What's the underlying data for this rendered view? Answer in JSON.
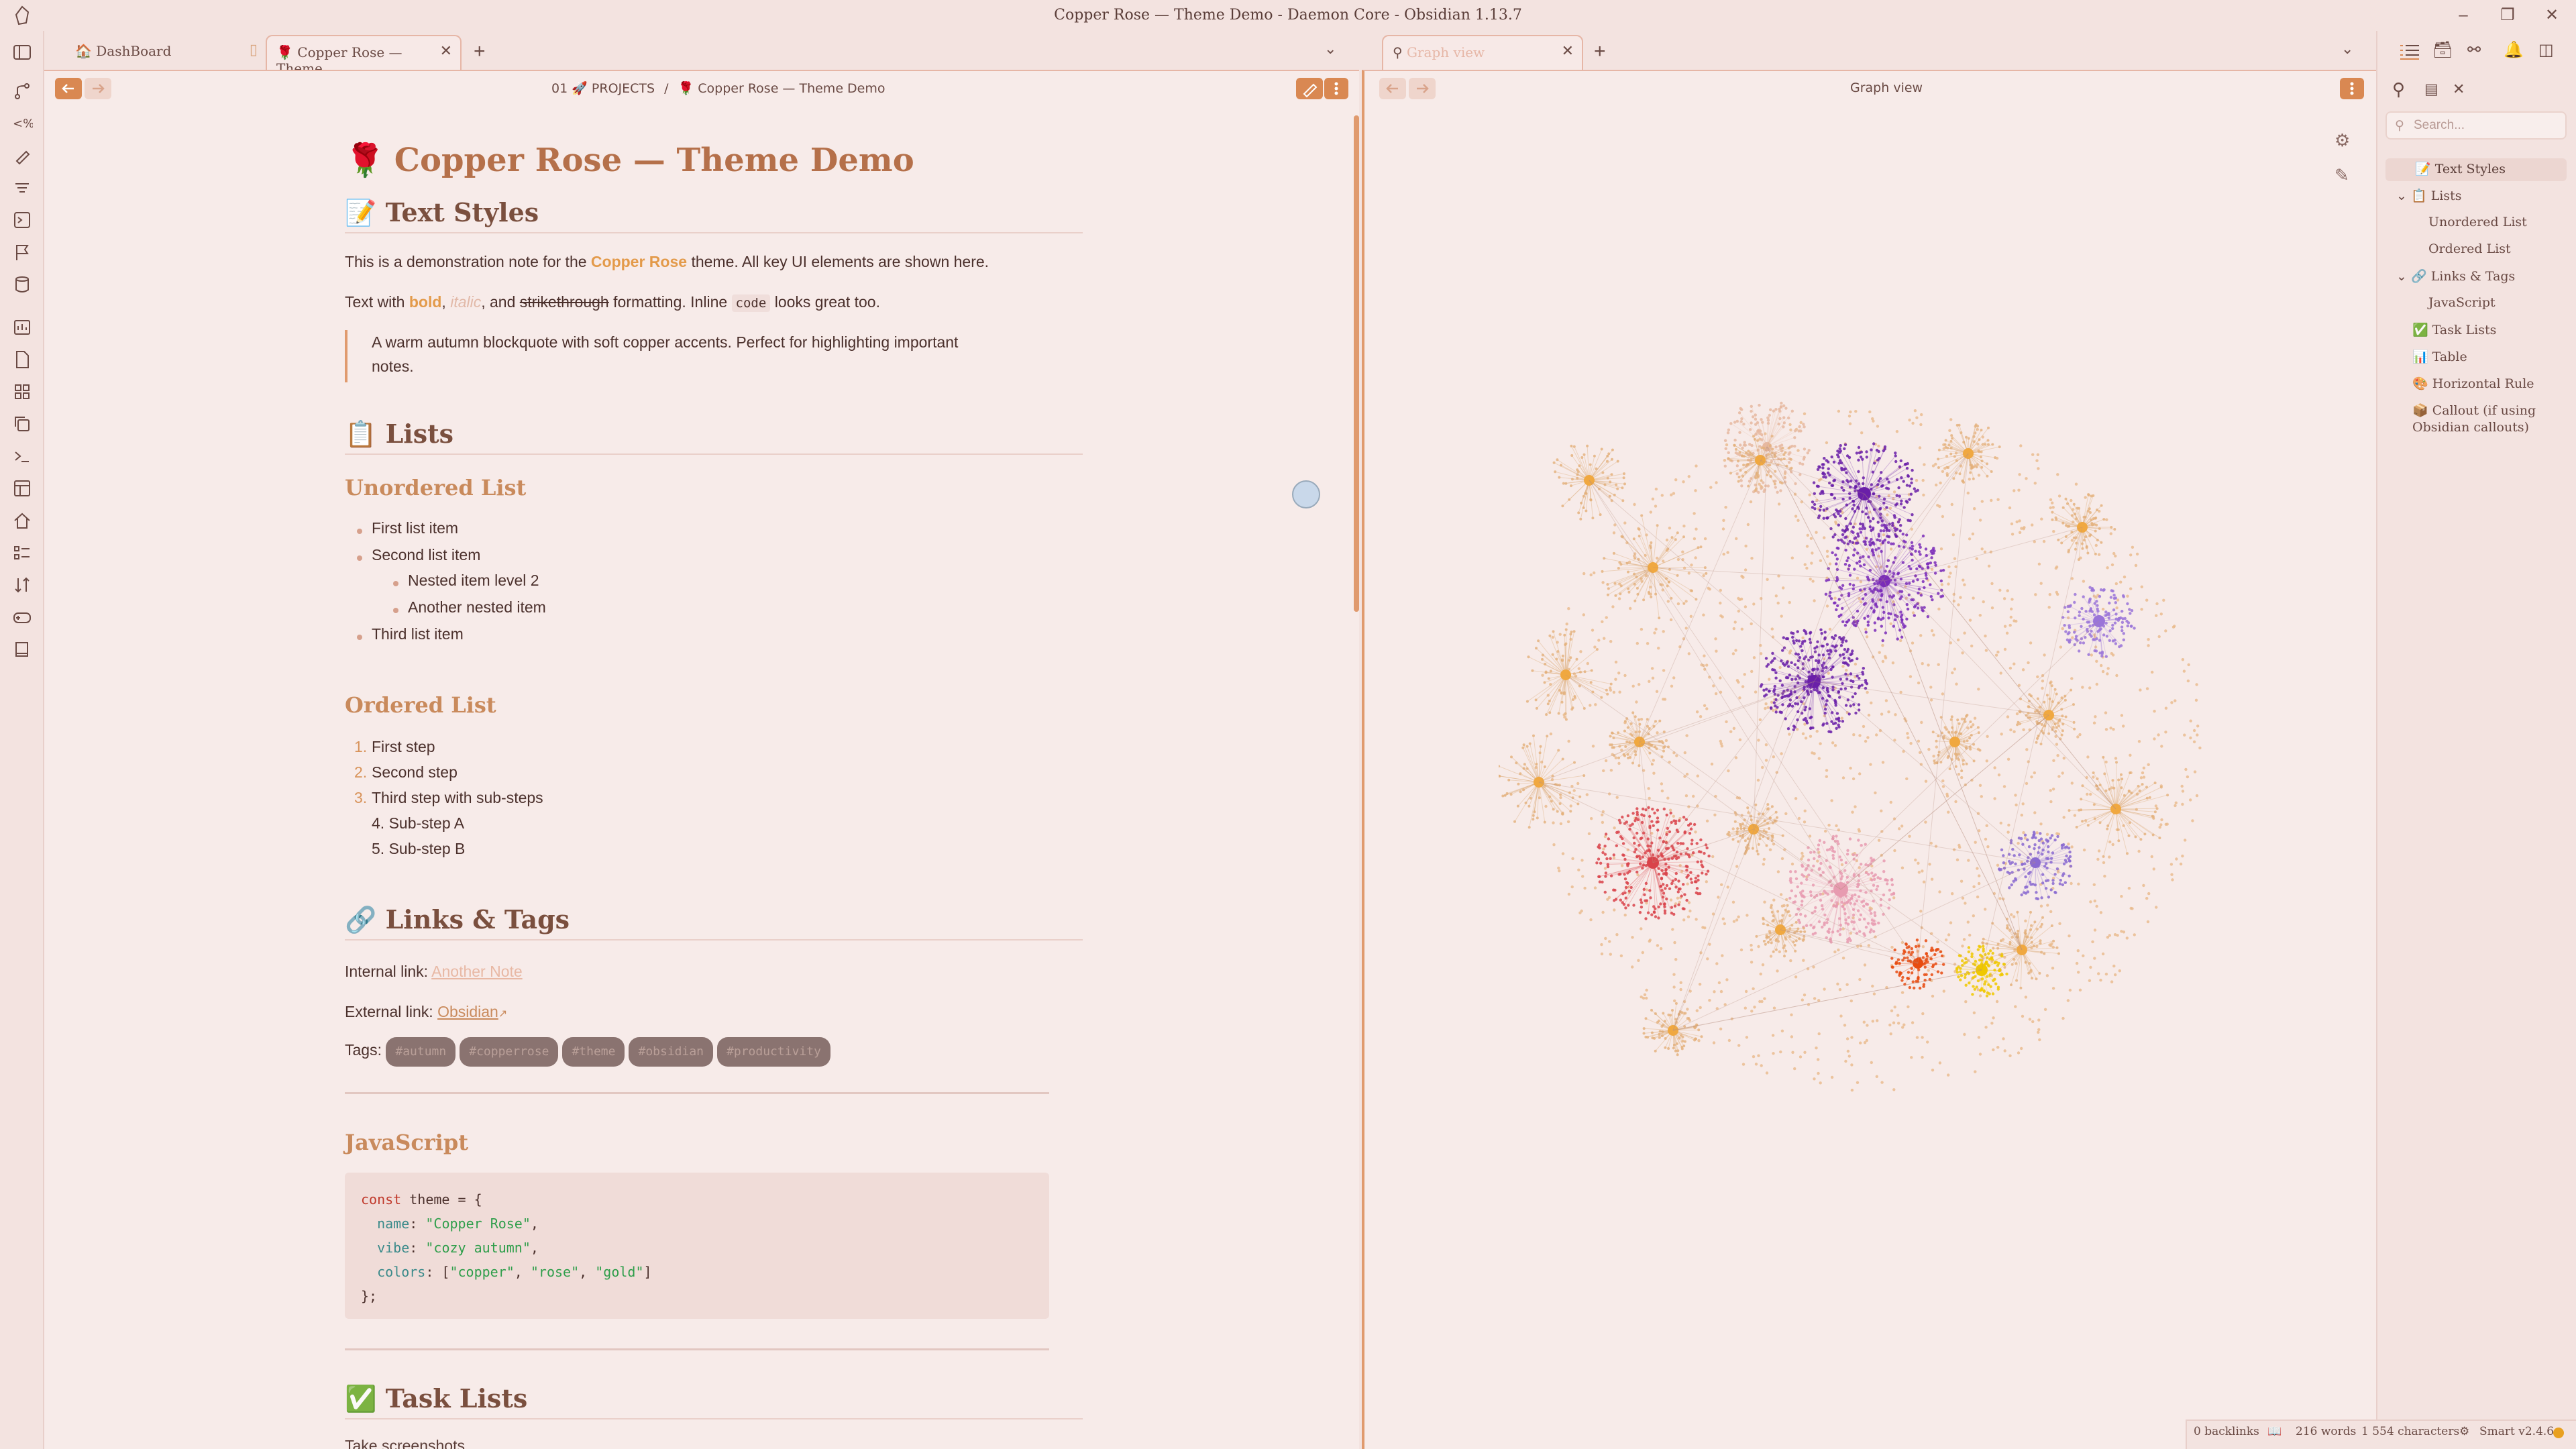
{
  "window": {
    "title": "Copper Rose — Theme Demo - Daemon Core - Obsidian 1.13.7"
  },
  "tabs_left": [
    {
      "label": "DashBoard",
      "active": false
    },
    {
      "label": "Copper Rose — Theme...",
      "active": true
    }
  ],
  "tabs_right": [
    {
      "label": "Graph view",
      "active": true
    }
  ],
  "breadcrumb": {
    "folder": "01 🚀 PROJECTS",
    "separator": "/",
    "note": "🌹 Copper Rose — Theme Demo"
  },
  "graph_header": "Graph view",
  "note": {
    "title": "Copper Rose — Theme Demo",
    "h_text_styles": "Text Styles",
    "p1_a": "This is a demonstration note for the ",
    "p1_b": "Copper Rose",
    "p1_c": " theme. All key UI elements are shown here.",
    "p2_a": "Text with ",
    "p2_bold": "bold",
    "p2_sep1": ", ",
    "p2_italic": "italic",
    "p2_sep2": ", and ",
    "p2_strike": "strikethrough",
    "p2_b": " formatting. Inline ",
    "p2_code": "code",
    "p2_c": " looks great too.",
    "blockquote_1": "A warm autumn blockquote with soft copper accents. Perfect for highlighting important",
    "blockquote_2": "notes.",
    "h_lists": "Lists",
    "h_unordered": "Unordered List",
    "ul": [
      "First list item",
      "Second list item",
      "Nested item level 2",
      "Another nested item",
      "Third list item"
    ],
    "h_ordered": "Ordered List",
    "ol_nums": [
      "1.",
      "2.",
      "3.",
      "4.",
      "5."
    ],
    "ol": [
      "First step",
      "Second step",
      "Third step with sub-steps",
      "Sub-step A",
      "Sub-step B"
    ],
    "h_links": "Links & Tags",
    "internal_label": "Internal link: ",
    "internal_link": "Another Note",
    "external_label": "External link: ",
    "external_link": "Obsidian",
    "tags_label": "Tags: ",
    "tags": [
      "#autumn",
      "#copperrose",
      "#theme",
      "#obsidian",
      "#productivity"
    ],
    "h_js": "JavaScript",
    "code_lines": [
      "const theme = {",
      "  name: \"Copper Rose\",",
      "  vibe: \"cozy autumn\",",
      "  colors: [\"copper\", \"rose\", \"gold\"]",
      "};"
    ],
    "h_tasks": "Task Lists",
    "task_partial": "Take screenshots"
  },
  "search": {
    "placeholder": "Search..."
  },
  "outline": [
    {
      "label": "Text Styles",
      "level": 0
    },
    {
      "label": "Lists",
      "level": 0
    },
    {
      "label": "Unordered List",
      "level": 1
    },
    {
      "label": "Ordered List",
      "level": 1
    },
    {
      "label": "Links & Tags",
      "level": 0
    },
    {
      "label": "JavaScript",
      "level": 1
    },
    {
      "label": "Task Lists",
      "level": 0
    },
    {
      "label": "Table",
      "level": 0
    },
    {
      "label": "Horizontal Rule",
      "level": 0
    },
    {
      "label": "Callout (if using",
      "level": 0
    },
    {
      "label": "Obsidian callouts)",
      "level": 0
    }
  ],
  "status": {
    "backlinks": "0 backlinks",
    "words": "216 words",
    "chars": "1 554 characters",
    "plugin": "Smart v2.4.6"
  },
  "colors": {
    "accent": "#d98852",
    "heading": "#b5704a",
    "bg": "#f7ebe9"
  }
}
